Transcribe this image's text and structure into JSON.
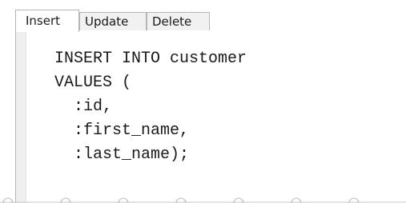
{
  "tabs": [
    {
      "label": "Insert",
      "active": true
    },
    {
      "label": "Update",
      "active": false
    },
    {
      "label": "Delete",
      "active": false
    }
  ],
  "editor": {
    "lines": [
      "INSERT INTO customer",
      "VALUES (",
      "  :id,",
      "  :first_name,",
      "  :last_name);"
    ]
  }
}
